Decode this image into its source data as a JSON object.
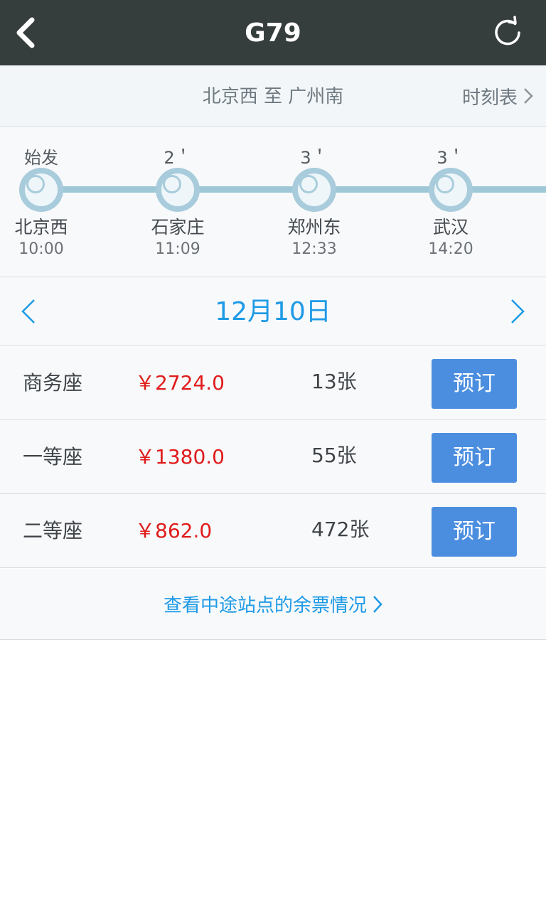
{
  "header": {
    "title": "G79",
    "back_icon": "chevron-left-icon",
    "refresh_icon": "refresh-icon"
  },
  "route": {
    "text": "北京西 至 广州南",
    "timetable_label": "时刻表"
  },
  "stations": [
    {
      "top": "始发",
      "name": "北京西",
      "time": "10:00"
    },
    {
      "top": "2＇",
      "name": "石家庄",
      "time": "11:09"
    },
    {
      "top": "3＇",
      "name": "郑州东",
      "time": "12:33"
    },
    {
      "top": "3＇",
      "name": "武汉",
      "time": "14:20"
    }
  ],
  "date": {
    "label": "12月10日"
  },
  "seats": [
    {
      "type": "商务座",
      "price": "￥2724.0",
      "count": "13张",
      "button": "预订"
    },
    {
      "type": "一等座",
      "price": "￥1380.0",
      "count": "55张",
      "button": "预订"
    },
    {
      "type": "二等座",
      "price": "￥862.0",
      "count": "472张",
      "button": "预订"
    }
  ],
  "transit_link": "查看中途站点的余票情况",
  "colors": {
    "header_bg": "#363d3d",
    "accent_blue": "#1d9ae6",
    "button_blue": "#4b8ee0",
    "price_red": "#e01b1b",
    "track": "#9fc8d7"
  }
}
